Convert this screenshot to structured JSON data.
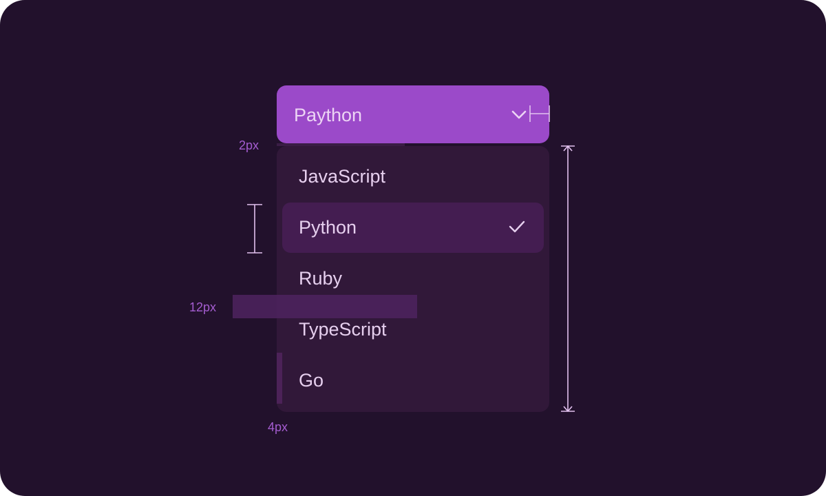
{
  "select": {
    "value": "Paython"
  },
  "menu": {
    "items": [
      {
        "label": "JavaScript",
        "selected": false
      },
      {
        "label": "Python",
        "selected": true
      },
      {
        "label": "Ruby",
        "selected": false
      },
      {
        "label": "TypeScript",
        "selected": false
      },
      {
        "label": "Go",
        "selected": false
      }
    ]
  },
  "annotations": {
    "gap_label": "2px",
    "padding_label": "12px",
    "bottom_label": "4px"
  },
  "icons": {
    "trigger_icon": "chevron-down-icon",
    "selected_icon": "check-icon"
  },
  "colors": {
    "background": "#22112c",
    "trigger": "#9b4ac9",
    "menu": "#311839",
    "selected_item": "#441d51",
    "annotation_text": "#a55dd1",
    "annotation_lines": "#e3c2f0"
  }
}
